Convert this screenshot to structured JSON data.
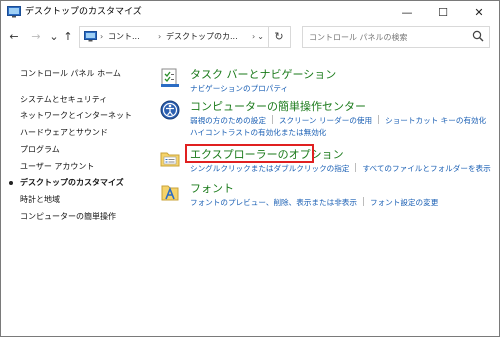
{
  "window": {
    "title": "デスクトップのカスタマイズ",
    "minimize_glyph": "—",
    "maximize_glyph": "☐",
    "close_glyph": "✕"
  },
  "nav": {
    "back_glyph": "←",
    "forward_glyph": "→",
    "recent_glyph": "⌄",
    "up_glyph": "↑",
    "refresh_glyph": "↻",
    "breadcrumbs": [
      "コント...",
      "デスクトップのカ...",
      ""
    ],
    "separator": "›",
    "dropdown_glyph": "⌄"
  },
  "search": {
    "placeholder": "コントロール パネルの検索"
  },
  "sidebar": {
    "items": [
      {
        "label": "コントロール パネル ホーム"
      },
      {
        "label": "システムとセキュリティ"
      },
      {
        "label": "ネットワークとインターネット"
      },
      {
        "label": "ハードウェアとサウンド"
      },
      {
        "label": "プログラム"
      },
      {
        "label": "ユーザー アカウント"
      },
      {
        "label": "デスクトップのカスタマイズ"
      },
      {
        "label": "時計と地域"
      },
      {
        "label": "コンピューターの簡単操作"
      }
    ]
  },
  "categories": [
    {
      "title": "タスク バーとナビゲーション",
      "links": [
        "ナビゲーションのプロパティ"
      ]
    },
    {
      "title": "コンピューターの簡単操作センター",
      "links": [
        "弱視の方のための設定",
        "スクリーン リーダーの使用",
        "ショートカット キーの有効化",
        "ハイコントラストの有効化または無効化"
      ]
    },
    {
      "title": "エクスプローラーのオプション",
      "links": [
        "シングルクリックまたはダブルクリックの指定",
        "すべてのファイルとフォルダーを表示"
      ]
    },
    {
      "title": "フォント",
      "links": [
        "フォントのプレビュー、削除、表示または非表示",
        "フォント設定の変更"
      ]
    }
  ],
  "colors": {
    "category_title": "#1a7a1a",
    "link": "#1a5fb4",
    "highlight_border": "#e02020"
  }
}
